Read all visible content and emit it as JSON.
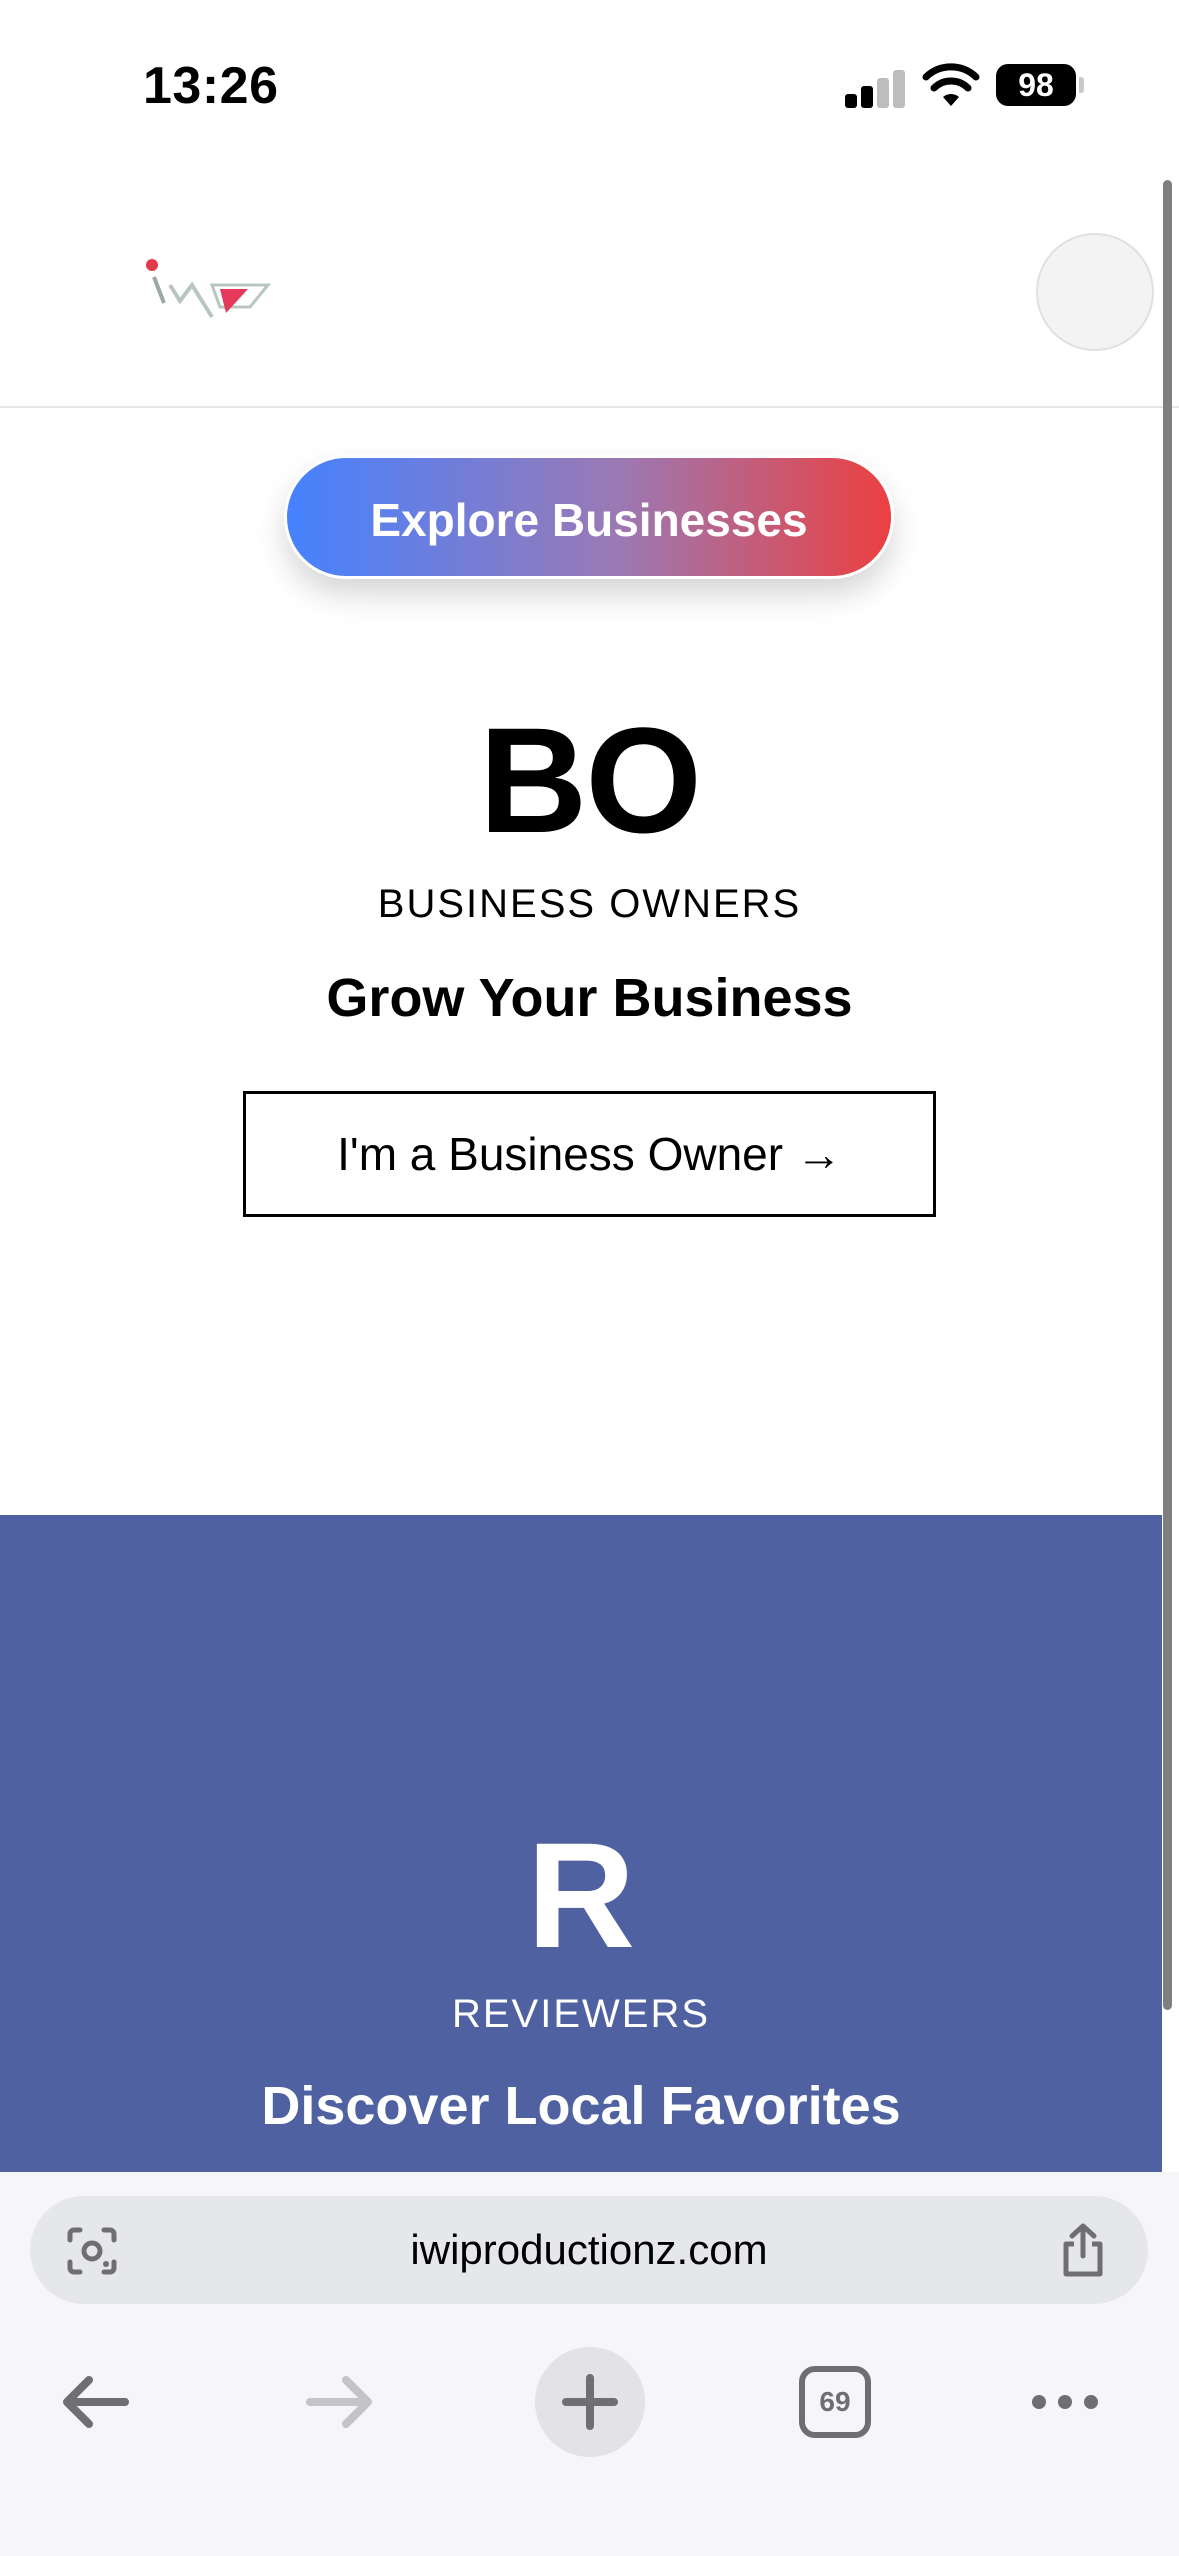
{
  "status_bar": {
    "time": "13:26",
    "battery": "98",
    "icons": [
      "cellular-signal-icon",
      "wifi-icon",
      "battery-icon"
    ]
  },
  "header": {
    "logo_icon": "iwp-logo",
    "profile_icon": "avatar-placeholder"
  },
  "explore_button": {
    "label": "Explore Businesses",
    "gradient": [
      "#4582ff",
      "#9b79b4",
      "#ec4040"
    ]
  },
  "business_owners": {
    "initials": "BO",
    "label": "BUSINESS OWNERS",
    "headline": "Grow Your Business",
    "button_label": "I'm a Business Owner →"
  },
  "reviewers": {
    "initials": "R",
    "label": "REVIEWERS",
    "headline": "Discover Local Favorites",
    "background": "#4f61a1"
  },
  "browser": {
    "url": "iwiproductionz.com",
    "tab_count": "69",
    "icons": [
      "visual-search-icon",
      "share-icon",
      "back-arrow-icon",
      "forward-arrow-icon",
      "plus-icon",
      "tabs-icon",
      "more-dots-icon"
    ]
  }
}
